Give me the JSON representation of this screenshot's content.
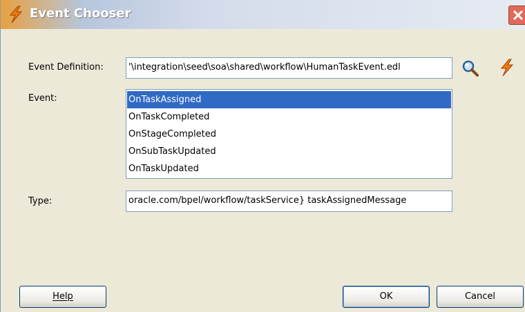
{
  "window": {
    "title": "Event Chooser",
    "icon": "lightning-bolt-icon",
    "close_icon": "close-icon"
  },
  "form": {
    "event_definition_label": "Event Definition:",
    "event_definition_value": "'\\integration\\seed\\soa\\shared\\workflow\\HumanTaskEvent.edl",
    "event_label": "Event:",
    "events": [
      {
        "label": "OnTaskAssigned",
        "selected": true
      },
      {
        "label": "OnTaskCompleted",
        "selected": false
      },
      {
        "label": "OnStageCompleted",
        "selected": false
      },
      {
        "label": "OnSubTaskUpdated",
        "selected": false
      },
      {
        "label": "OnTaskUpdated",
        "selected": false
      }
    ],
    "type_label": "Type:",
    "type_value": "oracle.com/bpel/workflow/taskService} taskAssignedMessage",
    "browse_icon": "search-icon",
    "create_icon": "lightning-bolt-icon"
  },
  "buttons": {
    "help": "Help",
    "ok": "OK",
    "cancel": "Cancel"
  },
  "colors": {
    "selection": "#316ac5",
    "dialog_bg": "#ece9d8",
    "border": "#7f9db9"
  }
}
